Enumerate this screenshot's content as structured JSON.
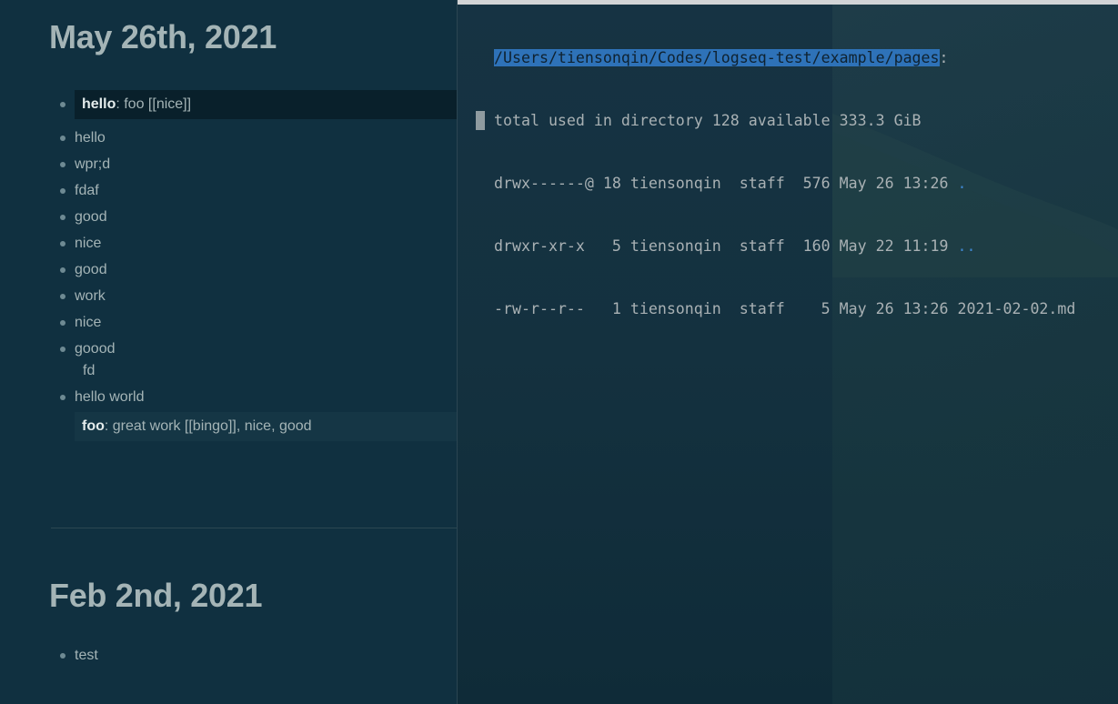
{
  "journal": {
    "pages": [
      {
        "title": "May 26th, 2021",
        "property_block": {
          "key": "hello",
          "value": ": foo [[nice]]"
        },
        "blocks": [
          "hello",
          "wpr;d",
          "fdaf",
          "good",
          "nice",
          "good",
          "work",
          "nice",
          "goood",
          "hello world"
        ],
        "goood_child": "fd",
        "footer_property": {
          "key": "foo",
          "value": ": great work [[bingo]], nice, good"
        }
      },
      {
        "title": "Feb 2nd, 2021",
        "blocks": [
          "test"
        ]
      }
    ]
  },
  "terminal": {
    "path": "/Users/tiensonqin/Codes/logseq-test/example/pages",
    "path_suffix": ":",
    "summary": "total used in directory 128 available 333.3 GiB",
    "entries": [
      {
        "text": "drwx------@ 18 tiensonqin  staff  576 May 26 13:26 ",
        "name": "."
      },
      {
        "text": "drwxr-xr-x   5 tiensonqin  staff  160 May 22 11:19 ",
        "name": ".."
      },
      {
        "text": "-rw-r--r--   1 tiensonqin  staff    5 May 26 13:26 ",
        "name": "2021-02-02.md"
      }
    ]
  },
  "colors": {
    "journal_bg": "#103040",
    "text": "#a4b4b6",
    "terminal_highlight": "#2e72b8",
    "dir_link": "#3e86cf"
  }
}
